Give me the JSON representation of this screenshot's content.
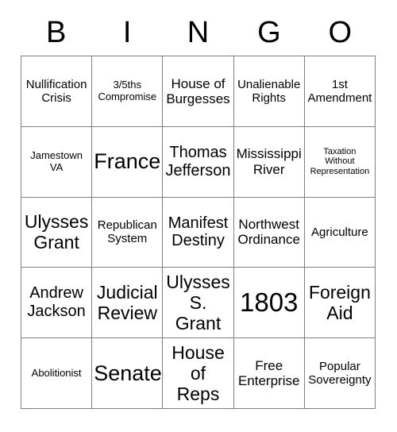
{
  "header": {
    "letters": [
      "B",
      "I",
      "N",
      "G",
      "O"
    ]
  },
  "style": {
    "grid_line_color": "#808080",
    "text_color": "#000000",
    "background_color": "#ffffff"
  },
  "grid": {
    "columns": 5,
    "rows": 5,
    "cells": [
      {
        "text": "Nullification\nCrisis",
        "size": "fs-m"
      },
      {
        "text": "3/5ths\nCompromise",
        "size": "fs-s"
      },
      {
        "text": "House of\nBurgesses",
        "size": "fs-ml"
      },
      {
        "text": "Unalienable\nRights",
        "size": "fs-m"
      },
      {
        "text": "1st\nAmendment",
        "size": "fs-m"
      },
      {
        "text": "Jamestown\nVA",
        "size": "fs-s"
      },
      {
        "text": "France",
        "size": "fs-xxl"
      },
      {
        "text": "Thomas\nJefferson",
        "size": "fs-l"
      },
      {
        "text": "Mississippi\nRiver",
        "size": "fs-ml"
      },
      {
        "text": "Taxation\nWithout\nRepresentation",
        "size": "fs-xs"
      },
      {
        "text": "Ulysses\nGrant",
        "size": "fs-xl"
      },
      {
        "text": "Republican\nSystem",
        "size": "fs-m"
      },
      {
        "text": "Manifest\nDestiny",
        "size": "fs-l"
      },
      {
        "text": "Northwest\nOrdinance",
        "size": "fs-ml"
      },
      {
        "text": "Agriculture",
        "size": "fs-m"
      },
      {
        "text": "Andrew\nJackson",
        "size": "fs-l"
      },
      {
        "text": "Judicial\nReview",
        "size": "fs-xl"
      },
      {
        "text": "Ulysses\nS.\nGrant",
        "size": "fs-xl"
      },
      {
        "text": "1803",
        "size": "fs-huge"
      },
      {
        "text": "Foreign\nAid",
        "size": "fs-xl"
      },
      {
        "text": "Abolitionist",
        "size": "fs-s"
      },
      {
        "text": "Senate",
        "size": "fs-xxl"
      },
      {
        "text": "House\nof\nReps",
        "size": "fs-xl"
      },
      {
        "text": "Free\nEnterprise",
        "size": "fs-ml"
      },
      {
        "text": "Popular\nSovereignty",
        "size": "fs-m"
      }
    ]
  }
}
